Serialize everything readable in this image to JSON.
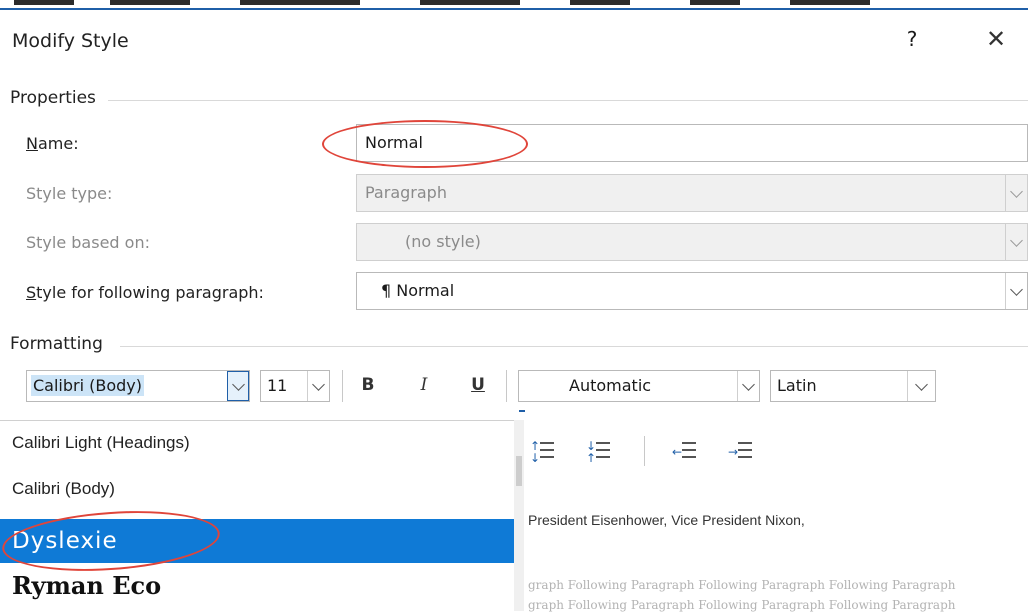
{
  "dialog": {
    "title": "Modify Style",
    "help_label": "?",
    "close_label": "✕"
  },
  "properties": {
    "section_label": "Properties",
    "name": {
      "label_u": "N",
      "label_rest": "ame:",
      "value": "Normal"
    },
    "style_type": {
      "label": "Style type:",
      "value": "Paragraph"
    },
    "style_based_on": {
      "label": "Style based on:",
      "value": "(no style)"
    },
    "following": {
      "label_u": "S",
      "label_rest": "tyle for following paragraph:",
      "value": "¶ Normal"
    }
  },
  "formatting": {
    "section_label": "Formatting",
    "font": "Calibri (Body)",
    "size": "11",
    "bold": "B",
    "italic": "I",
    "underline": "U",
    "color": "Automatic",
    "script": "Latin"
  },
  "font_list": [
    {
      "label": "Calibri Light (Headings)",
      "selected": false
    },
    {
      "label": "Calibri (Body)",
      "selected": false
    },
    {
      "label": "Dyslexie",
      "selected": true
    },
    {
      "label": "Ryman Eco",
      "selected": false
    }
  ],
  "preview": {
    "main": "President Eisenhower, Vice President Nixon,",
    "following_1": "graph Following Paragraph Following Paragraph Following Paragraph",
    "following_2": "graph Following Paragraph Following Paragraph Following Paragraph"
  },
  "colors": {
    "annotation": "#e0453a",
    "selection": "#0f7ad6"
  }
}
